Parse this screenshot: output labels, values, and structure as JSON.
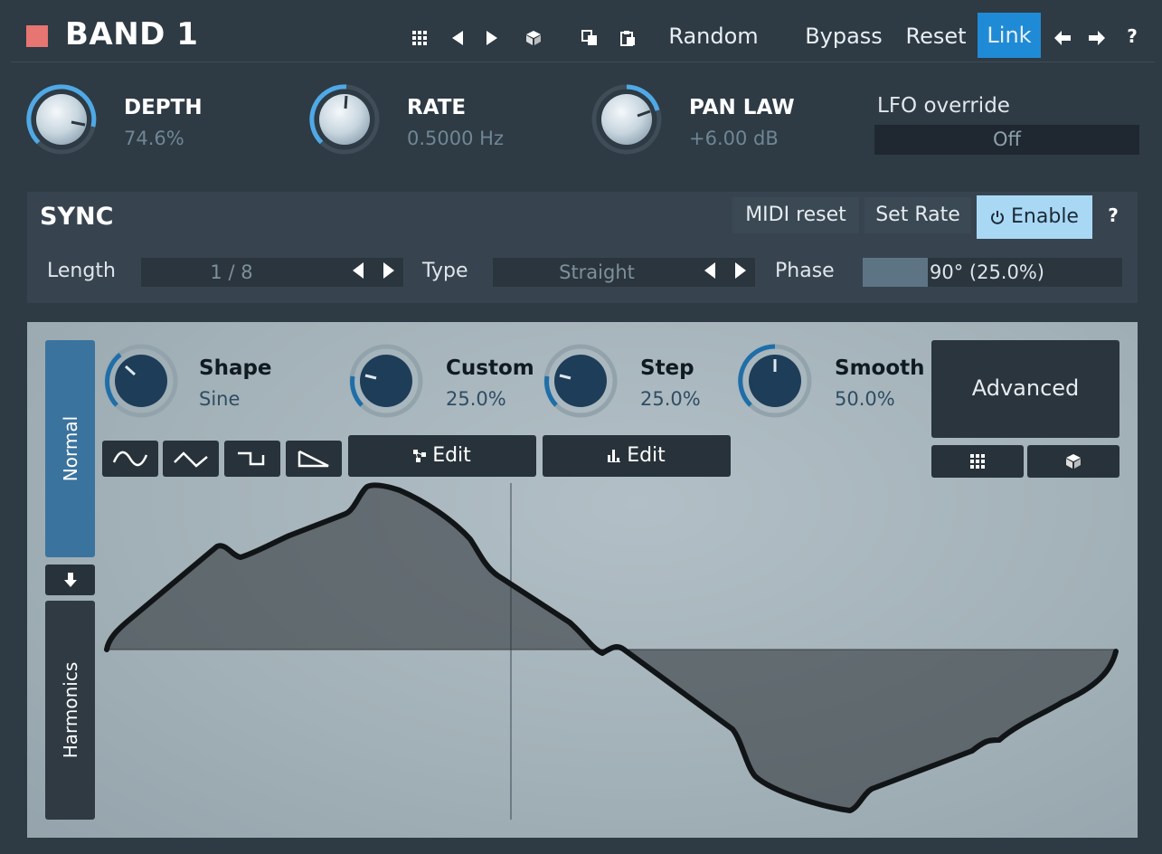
{
  "header": {
    "title": "BAND 1",
    "swatch_color": "#e77571",
    "icons": {
      "grid": "grid-icon",
      "prev": "triangle-left-icon",
      "next": "triangle-right-icon",
      "dice": "dice-icon",
      "copy": "copy-icon",
      "paste": "paste-icon",
      "undo": "arrow-left-icon",
      "redo": "arrow-right-icon",
      "help": "?"
    },
    "random_label": "Random",
    "bypass_label": "Bypass",
    "reset_label": "Reset",
    "link_label": "Link",
    "help_label": "?"
  },
  "knobs": {
    "depth": {
      "label": "DEPTH",
      "value": "74.6%"
    },
    "rate": {
      "label": "RATE",
      "value": "0.5000 Hz"
    },
    "pan_law": {
      "label": "PAN LAW",
      "value": "+6.00 dB"
    }
  },
  "lfo_override": {
    "label": "LFO override",
    "value": "Off"
  },
  "sync": {
    "title": "SYNC",
    "midi_reset_label": "MIDI reset",
    "set_rate_label": "Set Rate",
    "enable_icon": "power-icon",
    "enable_label": "Enable",
    "help_label": "?",
    "length_label": "Length",
    "length_value": "1 / 8",
    "type_label": "Type",
    "type_value": "Straight",
    "phase_label": "Phase",
    "phase_value": "90° (25.0%)",
    "phase_fraction": 0.25
  },
  "shape": {
    "tabs": {
      "normal": "Normal",
      "harmonics": "Harmonics"
    },
    "knobs": {
      "shape": {
        "label": "Shape",
        "value": "Sine"
      },
      "custom": {
        "label": "Custom",
        "value": "25.0%"
      },
      "step": {
        "label": "Step",
        "value": "25.0%"
      },
      "smooth": {
        "label": "Smooth",
        "value": "50.0%"
      }
    },
    "edit_label": "Edit",
    "advanced_label": "Advanced"
  },
  "colors": {
    "accent": "#1f8bd6",
    "enable": "#a9d8f5",
    "tab_active": "#3a739e"
  }
}
